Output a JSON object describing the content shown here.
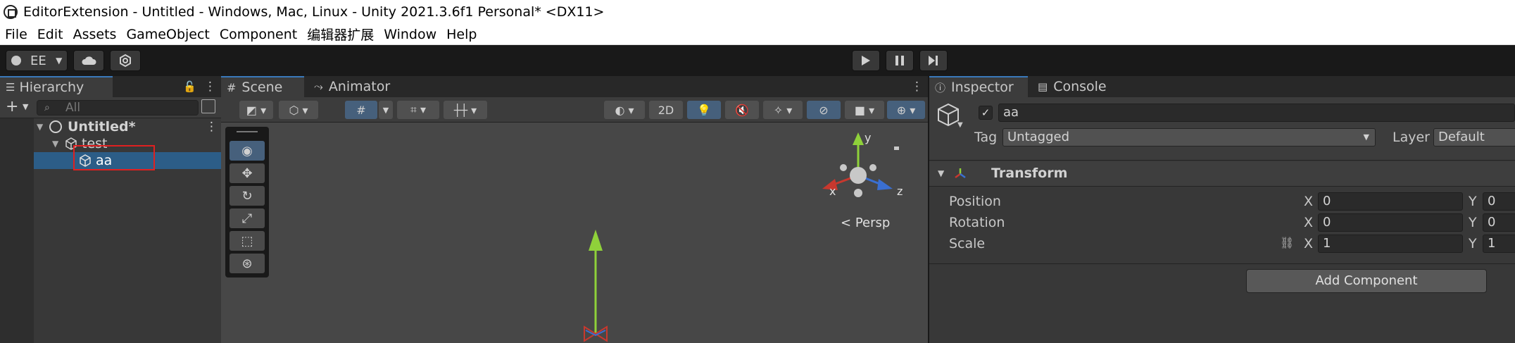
{
  "window": {
    "title": "EditorExtension - Untitled - Windows, Mac, Linux - Unity 2021.3.6f1 Personal* <DX11>"
  },
  "menu": [
    "File",
    "Edit",
    "Assets",
    "GameObject",
    "Component",
    "编辑器扩展",
    "Window",
    "Help"
  ],
  "toolbar": {
    "account_label": "EE"
  },
  "hierarchy": {
    "tab_label": "Hierarchy",
    "search_placeholder": "All",
    "items": [
      {
        "label": "Untitled*"
      },
      {
        "label": "test"
      },
      {
        "label": "aa"
      }
    ]
  },
  "scene": {
    "tabs": [
      "Scene",
      "Animator"
    ],
    "toggle_2d": "2D",
    "gizmo": {
      "y": "y",
      "x": "x",
      "z": "z",
      "persp": "Persp"
    }
  },
  "inspector": {
    "tabs": [
      "Inspector",
      "Console"
    ],
    "object_name": "aa",
    "tag_label": "Tag",
    "tag_value": "Untagged",
    "layer_label": "Layer",
    "layer_value": "Default",
    "component_title": "Transform",
    "rows": [
      {
        "label": "Position",
        "x": "0",
        "y": "0"
      },
      {
        "label": "Rotation",
        "x": "0",
        "y": "0"
      },
      {
        "label": "Scale",
        "x": "1",
        "y": "1"
      }
    ],
    "axis_x": "X",
    "axis_y": "Y",
    "add_component": "Add Component"
  }
}
